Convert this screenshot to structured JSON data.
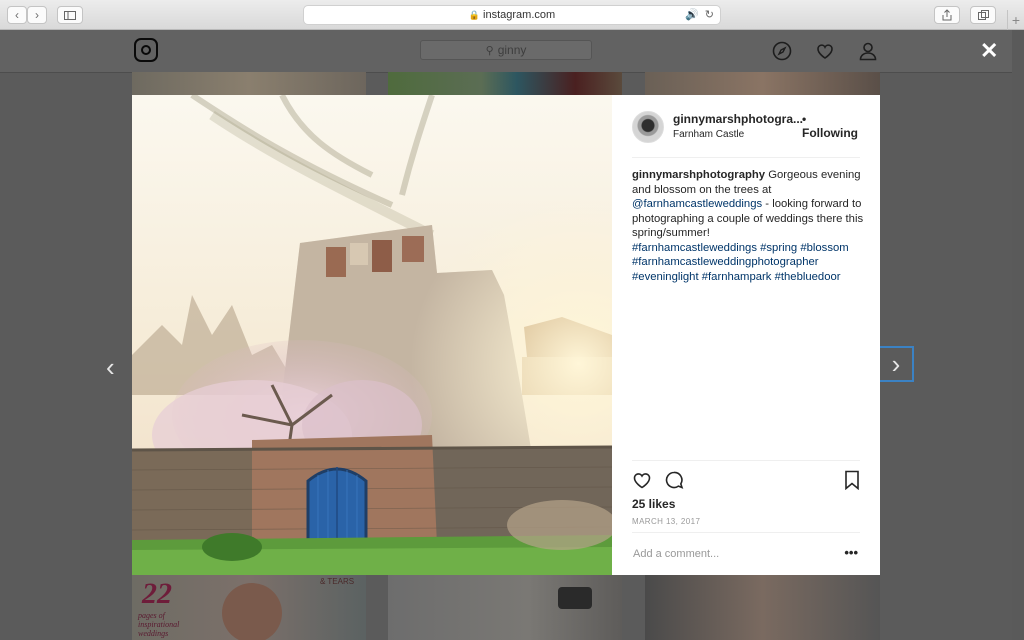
{
  "browser": {
    "url": "instagram.com"
  },
  "ig": {
    "search_text": "ginny"
  },
  "post": {
    "username": "ginnymarshphotogra...",
    "follow_status": "• Following",
    "location": "Farnham Castle",
    "caption_user": "ginnymarshphotography",
    "caption_text_1": " Gorgeous evening and blossom on the trees at ",
    "mention": "@farnhamcastleweddings",
    "caption_text_2": " - looking forward to photographing a couple of weddings there this spring/summer!",
    "hashtags": [
      "#farnhamcastleweddings",
      "#spring",
      "#blossom",
      "#farnhamcastleweddingphotographer",
      "#eveninglight",
      "#farnhampark",
      "#thebluedoor"
    ],
    "likes": "25 likes",
    "date": "MARCH 13, 2017",
    "comment_placeholder": "Add a comment...",
    "more_label": "•••"
  },
  "thumb_bottom_left": {
    "number": "22",
    "text": "pages of inspirational weddings",
    "tears": "& TEARS"
  },
  "colors": {
    "link": "#003569",
    "door": "#2a63a8",
    "arrow_highlight": "#3b82c4"
  }
}
